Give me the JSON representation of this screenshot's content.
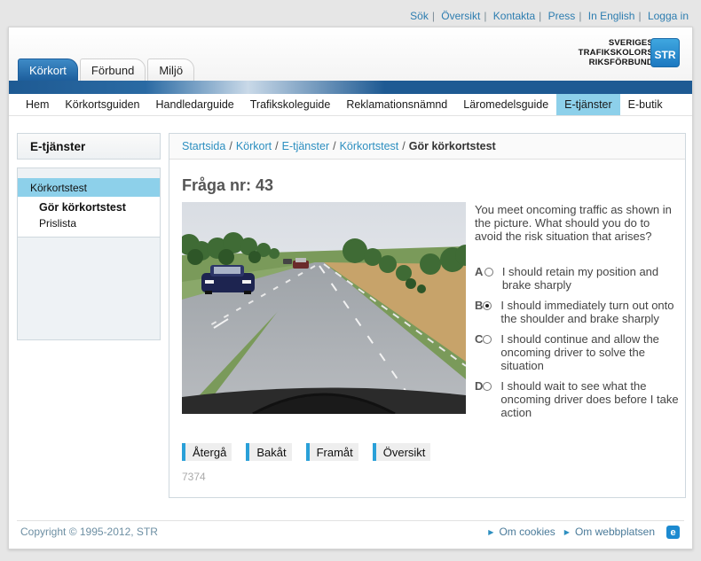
{
  "toplinks": [
    "Sök",
    "Översikt",
    "Kontakta",
    "Press",
    "In English",
    "Logga in"
  ],
  "logo": {
    "line1": "SVERIGES",
    "line2": "TRAFIKSKOLORS",
    "line3": "RIKSFÖRBUND",
    "mark": "STR"
  },
  "tabs": [
    "Körkort",
    "Förbund",
    "Miljö"
  ],
  "mainnav": [
    "Hem",
    "Körkortsguiden",
    "Handledarguide",
    "Trafikskoleguide",
    "Reklamationsnämnd",
    "Läromedelsguide",
    "E-tjänster",
    "E-butik"
  ],
  "sidebar": {
    "title": "E-tjänster",
    "head": "Körkortstest",
    "items": [
      "Gör körkortstest",
      "Prislista"
    ]
  },
  "breadcrumb": {
    "links": [
      "Startsida",
      "Körkort",
      "E-tjänster",
      "Körkortstest"
    ],
    "current": "Gör körkortstest"
  },
  "question": {
    "title": "Fråga nr: 43",
    "text": "You meet oncoming traffic as shown in the picture. What should you do to avoid the risk situation that arises?",
    "answers": [
      {
        "letter": "A",
        "text": "I should retain my position and brake sharply",
        "selected": false
      },
      {
        "letter": "B",
        "text": "I should immediately turn out onto the shoulder and brake sharply",
        "selected": true
      },
      {
        "letter": "C",
        "text": "I should continue and allow the oncoming driver to solve the situation",
        "selected": false
      },
      {
        "letter": "D",
        "text": "I should wait to see what the oncoming driver does before I take action",
        "selected": false
      }
    ]
  },
  "buttons": [
    "Återgå",
    "Bakåt",
    "Framåt",
    "Översikt"
  ],
  "code": "7374",
  "footer": {
    "copyright": "Copyright © 1995-2012, STR",
    "links": [
      "Om cookies",
      "Om webbplatsen"
    ]
  },
  "colors": {
    "accent": "#8dd0ea",
    "brand_blue": "#1e5a93",
    "link": "#2d8fc0"
  }
}
